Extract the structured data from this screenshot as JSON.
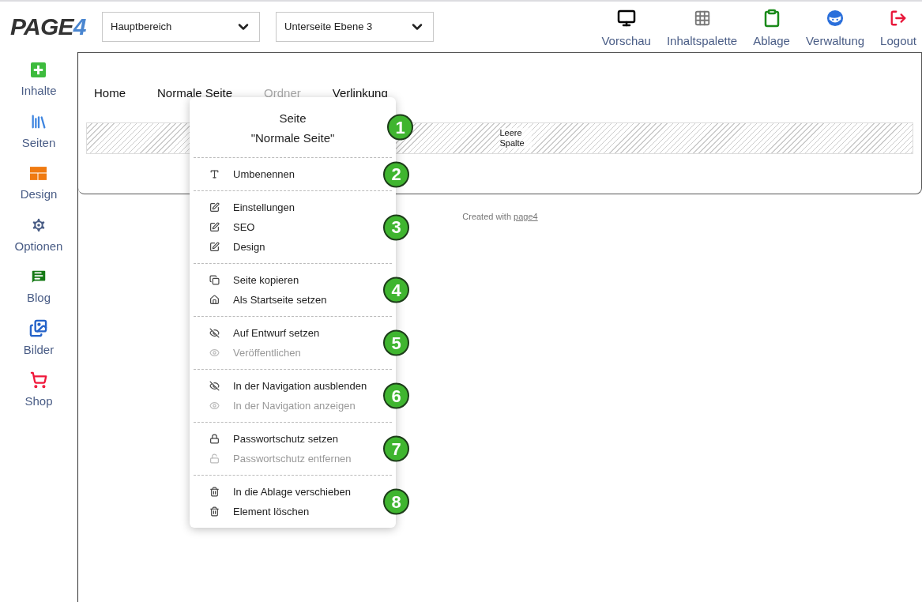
{
  "logo": {
    "text": "PAGE",
    "accent": "4"
  },
  "selects": [
    {
      "value": "Hauptbereich"
    },
    {
      "value": "Unterseite Ebene 3"
    }
  ],
  "toolbar": [
    {
      "label": "Vorschau",
      "color": "#000000"
    },
    {
      "label": "Inhaltspalette",
      "color": "#777777"
    },
    {
      "label": "Ablage",
      "color": "#1a8a1a"
    },
    {
      "label": "Verwaltung",
      "color": "#2a6fdb"
    },
    {
      "label": "Logout",
      "color": "#e8173a"
    }
  ],
  "sidebar": [
    {
      "label": "Inhalte",
      "color": "#3dbb3d"
    },
    {
      "label": "Seiten",
      "color": "#3f86e0"
    },
    {
      "label": "Design",
      "color": "#f07a10"
    },
    {
      "label": "Optionen",
      "color": "#4a5d86"
    },
    {
      "label": "Blog",
      "color": "#167a16"
    },
    {
      "label": "Bilder",
      "color": "#2563c9"
    },
    {
      "label": "Shop",
      "color": "#f0173a"
    }
  ],
  "nav": [
    {
      "label": "Home",
      "disabled": false
    },
    {
      "label": "Normale Seite",
      "disabled": false
    },
    {
      "label": "Ordner",
      "disabled": true
    },
    {
      "label": "Verlinkung",
      "disabled": false
    }
  ],
  "empty_column": "Leere Spalte",
  "footer": {
    "text": "Created with",
    "link": "page4"
  },
  "context_menu": {
    "title": "Seite",
    "subtitle": "\"Normale Seite\"",
    "badge": "1",
    "sections": [
      {
        "badge": "2",
        "items": [
          {
            "kind": "rename",
            "label": "Umbenennen",
            "disabled": false
          }
        ]
      },
      {
        "badge": "3",
        "items": [
          {
            "kind": "edit",
            "label": "Einstellungen",
            "disabled": false
          },
          {
            "kind": "edit",
            "label": "SEO",
            "disabled": false
          },
          {
            "kind": "edit",
            "label": "Design",
            "disabled": false
          }
        ]
      },
      {
        "badge": "4",
        "items": [
          {
            "kind": "copy",
            "label": "Seite kopieren",
            "disabled": false
          },
          {
            "kind": "home",
            "label": "Als Startseite setzen",
            "disabled": false
          }
        ]
      },
      {
        "badge": "5",
        "items": [
          {
            "kind": "hide",
            "label": "Auf Entwurf setzen",
            "disabled": false
          },
          {
            "kind": "show",
            "label": "Veröffentlichen",
            "disabled": true
          }
        ]
      },
      {
        "badge": "6",
        "items": [
          {
            "kind": "hide",
            "label": "In der Navigation ausblenden",
            "disabled": false
          },
          {
            "kind": "show",
            "label": "In der Navigation anzeigen",
            "disabled": true
          }
        ]
      },
      {
        "badge": "7",
        "items": [
          {
            "kind": "lock",
            "label": "Passwortschutz setzen",
            "disabled": false
          },
          {
            "kind": "unlock",
            "label": "Passwortschutz entfernen",
            "disabled": true
          }
        ]
      },
      {
        "badge": "8",
        "items": [
          {
            "kind": "trash",
            "label": "In die Ablage verschieben",
            "disabled": false
          },
          {
            "kind": "trash",
            "label": "Element löschen",
            "disabled": false
          }
        ]
      }
    ]
  }
}
